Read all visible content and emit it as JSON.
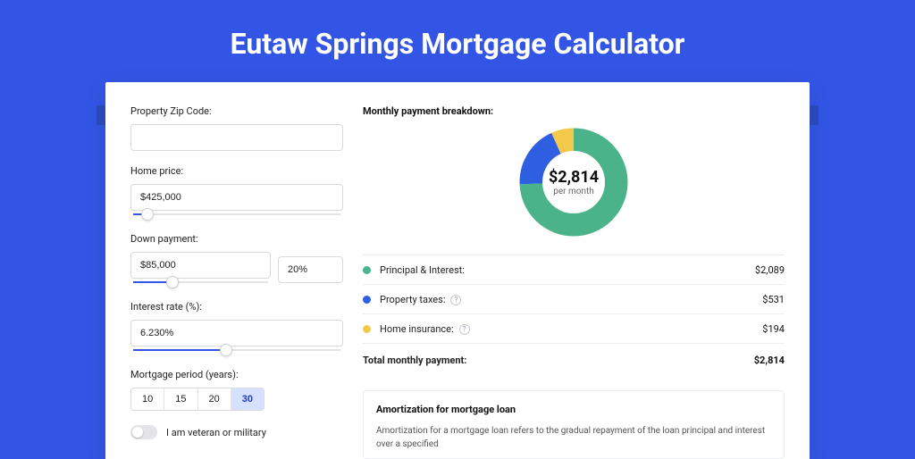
{
  "page": {
    "title": "Eutaw Springs Mortgage Calculator"
  },
  "form": {
    "zip_label": "Property Zip Code:",
    "zip_value": "",
    "home_price_label": "Home price:",
    "home_price_value": "$425,000",
    "home_price_slider_pct": 8,
    "down_label": "Down payment:",
    "down_value": "$85,000",
    "down_pct_value": "20%",
    "down_slider_pct": 30,
    "rate_label": "Interest rate (%):",
    "rate_value": "6.230%",
    "rate_slider_pct": 45,
    "period_label": "Mortgage period (years):",
    "period_options": [
      "10",
      "15",
      "20",
      "30"
    ],
    "period_selected": "30",
    "veteran_label": "I am veteran or military",
    "veteran_on": false
  },
  "breakdown": {
    "title": "Monthly payment breakdown:",
    "total_amount": "$2,814",
    "total_sub": "per month",
    "rows": [
      {
        "label": "Principal & Interest:",
        "value": "$2,089",
        "color": "#4bb38a",
        "info": false
      },
      {
        "label": "Property taxes:",
        "value": "$531",
        "color": "#2d5fe0",
        "info": true
      },
      {
        "label": "Home insurance:",
        "value": "$194",
        "color": "#f3c94a",
        "info": true
      }
    ],
    "total_row_label": "Total monthly payment:",
    "total_row_value": "$2,814"
  },
  "chart_data": {
    "type": "pie",
    "title": "Monthly payment breakdown",
    "series": [
      {
        "name": "Principal & Interest",
        "value": 2089,
        "color": "#4bb38a"
      },
      {
        "name": "Property taxes",
        "value": 531,
        "color": "#2d5fe0"
      },
      {
        "name": "Home insurance",
        "value": 194,
        "color": "#f3c94a"
      }
    ],
    "total": 2814,
    "center_label": "$2,814",
    "center_sub": "per month"
  },
  "amort": {
    "title": "Amortization for mortgage loan",
    "text": "Amortization for a mortgage loan refers to the gradual repayment of the loan principal and interest over a specified"
  }
}
